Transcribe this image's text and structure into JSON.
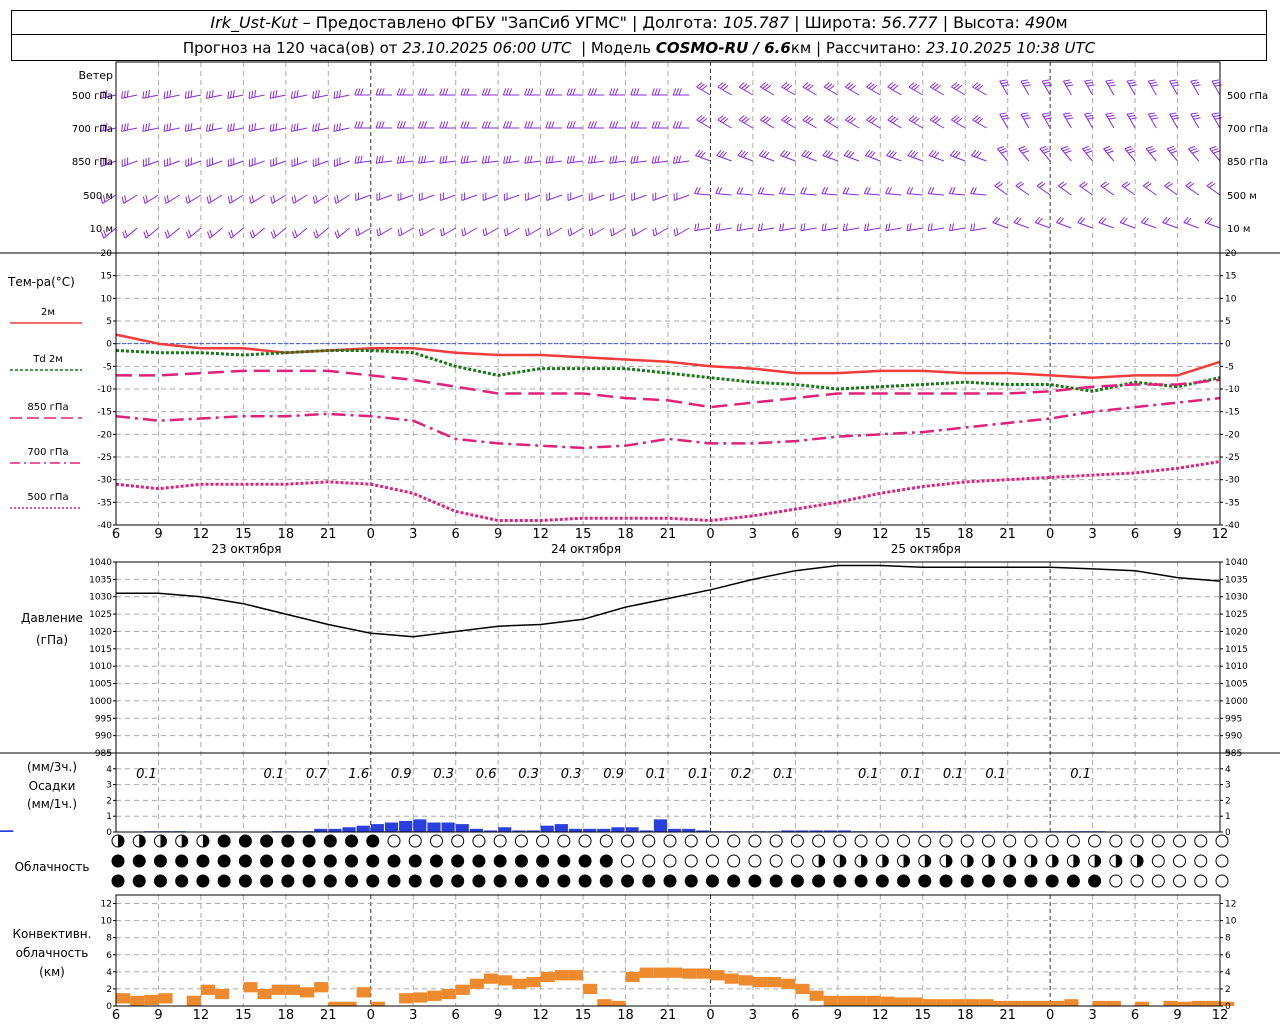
{
  "header": {
    "station": "Irk_Ust-Kut",
    "dash": " – ",
    "provided_by": "Предоставлено ФГБУ \"ЗапСиб УГМС\"",
    "sep": " | ",
    "lon_label": "Долгота:",
    "lon_value": "105.787",
    "lat_label": "Широта:",
    "lat_value": "56.777",
    "alt_label": "Высота:",
    "alt_value": "490",
    "alt_unit": "м",
    "forecast_label": "Прогноз на 120 часа(ов) от",
    "forecast_start": "23.10.2025 06:00 UTC",
    "model_label": "Модель",
    "model_name": "COSMO-RU / 6.6",
    "model_unit": "км",
    "calc_label": "Рассчитано:",
    "calc_time": "23.10.2025 10:38 UTC"
  },
  "colors": {
    "wind": "#8a2be2",
    "t2m": "#f03c3c",
    "td2m": "#187818",
    "t850": "#e0207a",
    "t700": "#e0207a",
    "t500": "#e0207a",
    "pressure": "#000000",
    "precip": "#2a3fe0",
    "convective": "#ee8a2e",
    "grid": "#aaaaaa",
    "zero_line": "#3b5bdb"
  },
  "time_axis": {
    "hour_ticks": [
      "6",
      "9",
      "12",
      "15",
      "18",
      "21",
      "0",
      "3",
      "6",
      "9",
      "12",
      "15",
      "18",
      "21",
      "0",
      "3",
      "6",
      "9",
      "12",
      "15",
      "18",
      "21",
      "0",
      "3",
      "6",
      "9",
      "12"
    ],
    "day_labels": [
      "23 октября",
      "24 октября",
      "25 октября"
    ]
  },
  "wind_panel": {
    "title": "Ветер",
    "levels": [
      "500 гПа",
      "700 гПа",
      "850 гПа",
      "500 м",
      "10  м"
    ]
  },
  "temp_panel": {
    "title": "Тем-ра(°C)",
    "legend": [
      {
        "label": "2м",
        "style": "solid"
      },
      {
        "label": "Td  2м",
        "style": "dotted"
      },
      {
        "label": "850 гПа",
        "style": "longdash"
      },
      {
        "label": "700 гПа",
        "style": "dashdot"
      },
      {
        "label": "500 гПа",
        "style": "dot"
      }
    ],
    "yticks": [
      "20",
      "15",
      "10",
      "5",
      "0",
      "-5",
      "-10",
      "-15",
      "-20",
      "-25",
      "-30",
      "-35",
      "-40"
    ]
  },
  "pressure_panel": {
    "title": "Давление",
    "unit": "(гПа)",
    "yticks": [
      "1040",
      "1035",
      "1030",
      "1025",
      "1020",
      "1015",
      "1010",
      "1005",
      "1000",
      "995",
      "990",
      "985"
    ]
  },
  "precip_panel": {
    "unit3h": "(мм/3ч.)",
    "title": "Осадки",
    "unit1h": "(мм/1ч.)",
    "yticks": [
      "5",
      "4",
      "3",
      "2",
      "1",
      "0"
    ],
    "labels": [
      {
        "h": 3,
        "text": "0.1"
      },
      {
        "h": 12,
        "text": "0.1"
      },
      {
        "h": 15,
        "text": "0.7"
      },
      {
        "h": 18,
        "text": "1.6"
      },
      {
        "h": 21,
        "text": "0.9"
      },
      {
        "h": 24,
        "text": "0.3"
      },
      {
        "h": 27,
        "text": "0.6"
      },
      {
        "h": 30,
        "text": "0.3"
      },
      {
        "h": 33,
        "text": "0.3"
      },
      {
        "h": 36,
        "text": "0.9"
      },
      {
        "h": 39,
        "text": "0.1"
      },
      {
        "h": 42,
        "text": "0.1"
      },
      {
        "h": 45,
        "text": "0.2"
      },
      {
        "h": 48,
        "text": "0.1"
      },
      {
        "h": 54,
        "text": "0.1"
      },
      {
        "h": 57,
        "text": "0.1"
      },
      {
        "h": 60,
        "text": "0.1"
      },
      {
        "h": 63,
        "text": "0.1"
      },
      {
        "h": 69,
        "text": "0.1"
      }
    ]
  },
  "cloud_panel": {
    "title": "Облачность"
  },
  "conv_panel": {
    "title1": "Конвективн.",
    "title2": "облачность",
    "unit": "(км)",
    "yticks": [
      "12",
      "10",
      "8",
      "6",
      "4",
      "2",
      "0"
    ]
  },
  "chart_data": [
    {
      "type": "line",
      "title": "Тем-ра(°C)",
      "ylim": [
        -40,
        20
      ],
      "x_hours_from_start": [
        0,
        3,
        6,
        9,
        12,
        15,
        18,
        21,
        24,
        27,
        30,
        33,
        36,
        39,
        42,
        45,
        48,
        51,
        54,
        57,
        60,
        63,
        66,
        69,
        72,
        75,
        78
      ],
      "series": [
        {
          "name": "2м",
          "values": [
            2,
            0,
            -1,
            -1,
            -2,
            -1.5,
            -1,
            -1,
            -2,
            -2.5,
            -2.5,
            -3,
            -3.5,
            -4,
            -5,
            -5.5,
            -6.5,
            -6.5,
            -6,
            -6,
            -6.5,
            -6.5,
            -7,
            -7.5,
            -7,
            -7,
            -4
          ]
        },
        {
          "name": "Td  2м",
          "values": [
            -1.5,
            -2,
            -2,
            -2.5,
            -2,
            -1.5,
            -1.5,
            -2,
            -5,
            -7,
            -5.5,
            -5.5,
            -5.5,
            -6.5,
            -7.5,
            -8.5,
            -9,
            -10,
            -9.5,
            -9,
            -8.5,
            -9,
            -9,
            -10.5,
            -8.5,
            -9.5,
            -7.5
          ]
        },
        {
          "name": "850 гПа",
          "values": [
            -7,
            -7,
            -6.5,
            -6,
            -6,
            -6,
            -7,
            -8,
            -9.5,
            -11,
            -11,
            -11,
            -12,
            -12.5,
            -14,
            -13,
            -12,
            -11,
            -11,
            -11,
            -11,
            -11,
            -10.5,
            -9.5,
            -9,
            -9,
            -8
          ]
        },
        {
          "name": "700 гПа",
          "values": [
            -16,
            -17,
            -16.5,
            -16,
            -16,
            -15.5,
            -16,
            -17,
            -21,
            -22,
            -22.5,
            -23,
            -22.5,
            -21,
            -22,
            -22,
            -21.5,
            -20.5,
            -20,
            -19.5,
            -18.5,
            -17.5,
            -16.5,
            -15,
            -14,
            -13,
            -12
          ]
        },
        {
          "name": "500 гПа",
          "values": [
            -31,
            -32,
            -31,
            -31,
            -31,
            -30.5,
            -31,
            -33,
            -37,
            -39,
            -39,
            -38.5,
            -38.5,
            -38.5,
            -39,
            -38,
            -36.5,
            -35,
            -33,
            -31.5,
            -30.5,
            -30,
            -29.5,
            -29,
            -28.5,
            -27.5,
            -26
          ]
        }
      ]
    },
    {
      "type": "line",
      "title": "Давление",
      "ylim": [
        985,
        1040
      ],
      "x_hours_from_start": [
        0,
        3,
        6,
        9,
        12,
        15,
        18,
        21,
        24,
        27,
        30,
        33,
        36,
        39,
        42,
        45,
        48,
        51,
        54,
        57,
        60,
        63,
        66,
        69,
        72,
        75,
        78
      ],
      "series": [
        {
          "name": "Давление",
          "values": [
            1031,
            1031,
            1030,
            1028,
            1025,
            1022,
            1019.5,
            1018.5,
            1020,
            1021.5,
            1022,
            1023.5,
            1027,
            1029.5,
            1032,
            1035,
            1037.5,
            1039,
            1039,
            1038.5,
            1038.5,
            1038.5,
            1038.5,
            1038,
            1037.5,
            1035.5,
            1034.5
          ]
        }
      ]
    },
    {
      "type": "bar",
      "title": "Осадки",
      "ylim": [
        0,
        5
      ],
      "x_hours_from_start": [
        3,
        4,
        5,
        6,
        7,
        8,
        9,
        10,
        11,
        12,
        13,
        14,
        15,
        16,
        17,
        18,
        19,
        20,
        21,
        22,
        23,
        24,
        25,
        26,
        27,
        28,
        29,
        30,
        31,
        32,
        33,
        34,
        35,
        36,
        37,
        38,
        39,
        40,
        41,
        42,
        43,
        44,
        45,
        46,
        47,
        48,
        49,
        50,
        51,
        52,
        53,
        54,
        55,
        56,
        57,
        58,
        59,
        60,
        61,
        62,
        63,
        64,
        65,
        66,
        67,
        68,
        69,
        70
      ],
      "series": [
        {
          "name": "мм/1ч.",
          "values": [
            0.05,
            0.05,
            0.05,
            0.02,
            0.02,
            0.02,
            0.02,
            0.02,
            0.02,
            0.05,
            0.05,
            0.05,
            0.2,
            0.2,
            0.3,
            0.4,
            0.5,
            0.6,
            0.7,
            0.8,
            0.6,
            0.6,
            0.5,
            0.2,
            0.1,
            0.3,
            0.1,
            0.1,
            0.4,
            0.5,
            0.2,
            0.2,
            0.2,
            0.3,
            0.3,
            0.1,
            0.8,
            0.2,
            0.2,
            0.1,
            0.05,
            0.05,
            0.05,
            0.05,
            0.05,
            0.1,
            0.1,
            0.1,
            0.1,
            0.1,
            0.05,
            0.05,
            0.05,
            0.05,
            0.05,
            0.05,
            0.05,
            0.05,
            0.05,
            0.05,
            0.05,
            0.05,
            0.05,
            0.05,
            0.05,
            0.05,
            0.05,
            0.05,
            0.1,
            0.1,
            0.1,
            0.05
          ]
        }
      ]
    },
    {
      "type": "bar",
      "title": "Конвективн. облачность",
      "ylim": [
        0,
        13
      ],
      "x_hours_from_start": [
        0,
        1,
        2,
        3,
        4,
        5,
        6,
        7,
        8,
        9,
        10,
        11,
        12,
        13,
        14,
        15,
        16,
        17,
        18,
        19,
        20,
        21,
        22,
        23,
        24,
        25,
        26,
        27,
        28,
        29,
        30,
        31,
        32,
        33,
        34,
        35,
        36,
        37,
        38,
        39,
        40,
        41,
        42,
        43,
        44,
        45,
        46,
        47,
        48,
        49,
        50,
        51,
        52,
        53,
        54,
        55,
        56,
        57,
        58,
        59,
        60,
        61,
        62,
        63,
        64,
        65,
        66,
        67,
        68,
        69,
        70,
        71,
        72,
        73,
        74,
        75,
        76,
        77,
        78
      ],
      "series": [
        {
          "name": "км",
          "values": [
            1.5,
            1.2,
            1.3,
            1.5,
            0,
            1.2,
            2.5,
            2,
            0,
            2.8,
            2,
            2.5,
            2.5,
            2.2,
            2.8,
            0.5,
            0.5,
            2.2,
            0.5,
            0,
            1.5,
            1.6,
            1.8,
            2,
            2.5,
            3.2,
            3.8,
            3.6,
            3.2,
            3.4,
            4,
            4.2,
            4.2,
            2.6,
            0.8,
            0.6,
            4,
            4.5,
            4.5,
            4.5,
            4.4,
            4.4,
            4.2,
            3.8,
            3.6,
            3.4,
            3.4,
            3.2,
            2.6,
            1.8,
            1.2,
            1.2,
            1.2,
            1.2,
            1.1,
            1,
            1,
            0.8,
            0.8,
            0.8,
            0.8,
            0.8,
            0.6,
            0.6,
            0.6,
            0.6,
            0.6,
            0.8,
            0,
            0.6,
            0.6,
            0,
            0.5,
            0,
            0.6,
            0.5,
            0.6,
            0.6,
            0.5
          ]
        }
      ]
    }
  ]
}
